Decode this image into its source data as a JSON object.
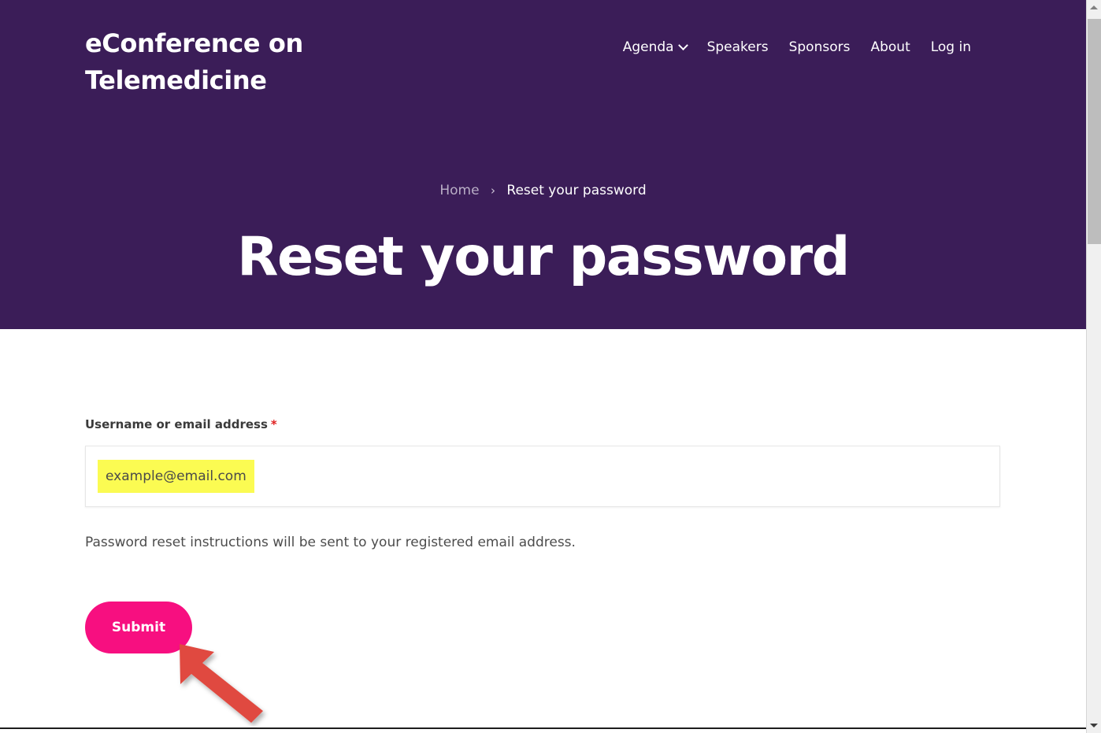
{
  "site": {
    "title": "eConference on\nTelemedicine"
  },
  "nav": {
    "items": [
      {
        "label": "Agenda",
        "has_dropdown": true,
        "icon": "chevron-down-icon"
      },
      {
        "label": "Speakers",
        "has_dropdown": false
      },
      {
        "label": "Sponsors",
        "has_dropdown": false
      },
      {
        "label": "About",
        "has_dropdown": false
      },
      {
        "label": "Log in",
        "has_dropdown": false
      }
    ]
  },
  "breadcrumb": {
    "home": "Home",
    "separator": "›",
    "current": "Reset your password"
  },
  "hero": {
    "title": "Reset your password",
    "background_color": "#3b1d58"
  },
  "form": {
    "field_label": "Username or email address",
    "required_marker": "*",
    "input": {
      "value": "example@email.com",
      "placeholder": "",
      "highlight_color": "#fbfb52"
    },
    "help_text": "Password reset instructions will be sent to your registered email address.",
    "submit_label": "Submit",
    "submit_color": "#f70f80"
  },
  "annotation": {
    "arrow_color": "#e04a3f",
    "points_to": "submit-button"
  },
  "scrollbar": {
    "up_arrow": "triangle-up-icon",
    "down_arrow": "triangle-down-icon"
  }
}
